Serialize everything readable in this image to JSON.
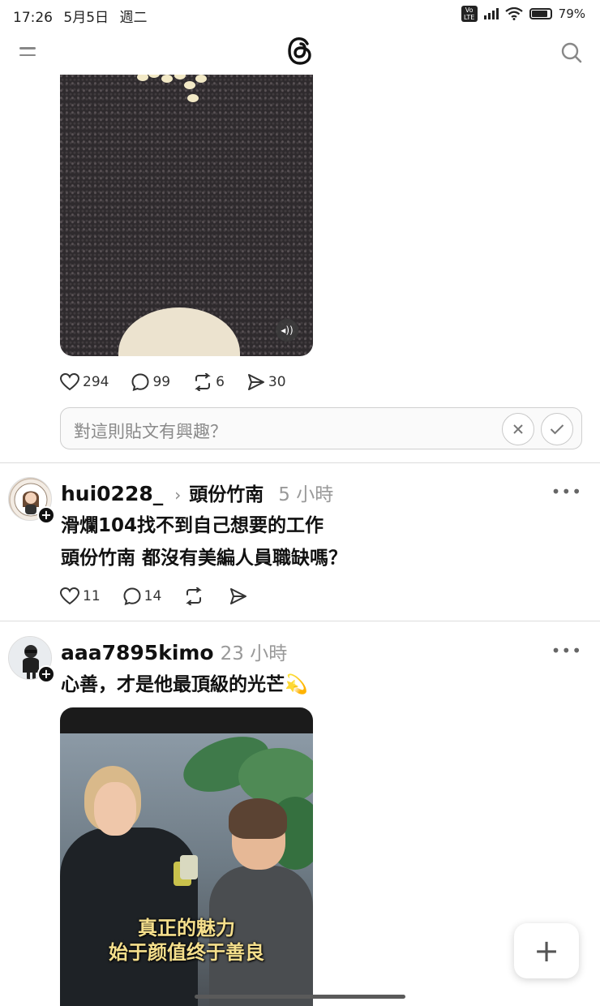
{
  "status_bar": {
    "time": "17:26",
    "date": "5月5日",
    "weekday": "週二",
    "volte": "VoLTE",
    "battery": "79%"
  },
  "nav": {
    "logo": "threads-logo",
    "menu_icon": "menu-icon",
    "search_icon": "search-icon"
  },
  "post1": {
    "likes": "294",
    "comments": "99",
    "reposts": "6",
    "shares": "30",
    "sound_icon": "speaker-icon"
  },
  "interest": {
    "placeholder": "對這則貼文有興趣？",
    "dismiss_icon": "close-icon",
    "confirm_icon": "check-icon"
  },
  "post2": {
    "username": "hui0228_",
    "topic": "頭份竹南",
    "time": "5 小時",
    "lines": [
      "滑爛104找不到自己想要的工作",
      "頭份竹南 都沒有美編人員職缺嗎？"
    ],
    "likes": "11",
    "comments": "14"
  },
  "post3": {
    "username": "aaa7895kimo",
    "time": "23 小時",
    "text": "心善，才是他最頂級的光芒",
    "emoji": "💫",
    "subtitle_lines": [
      "真正的魅力",
      "始于颜值终于善良"
    ]
  },
  "fab": {
    "label": "+"
  },
  "colors": {
    "text": "#111111",
    "muted": "#999999",
    "divider": "#dcdcdc",
    "subtitle": "#f5df8c"
  }
}
